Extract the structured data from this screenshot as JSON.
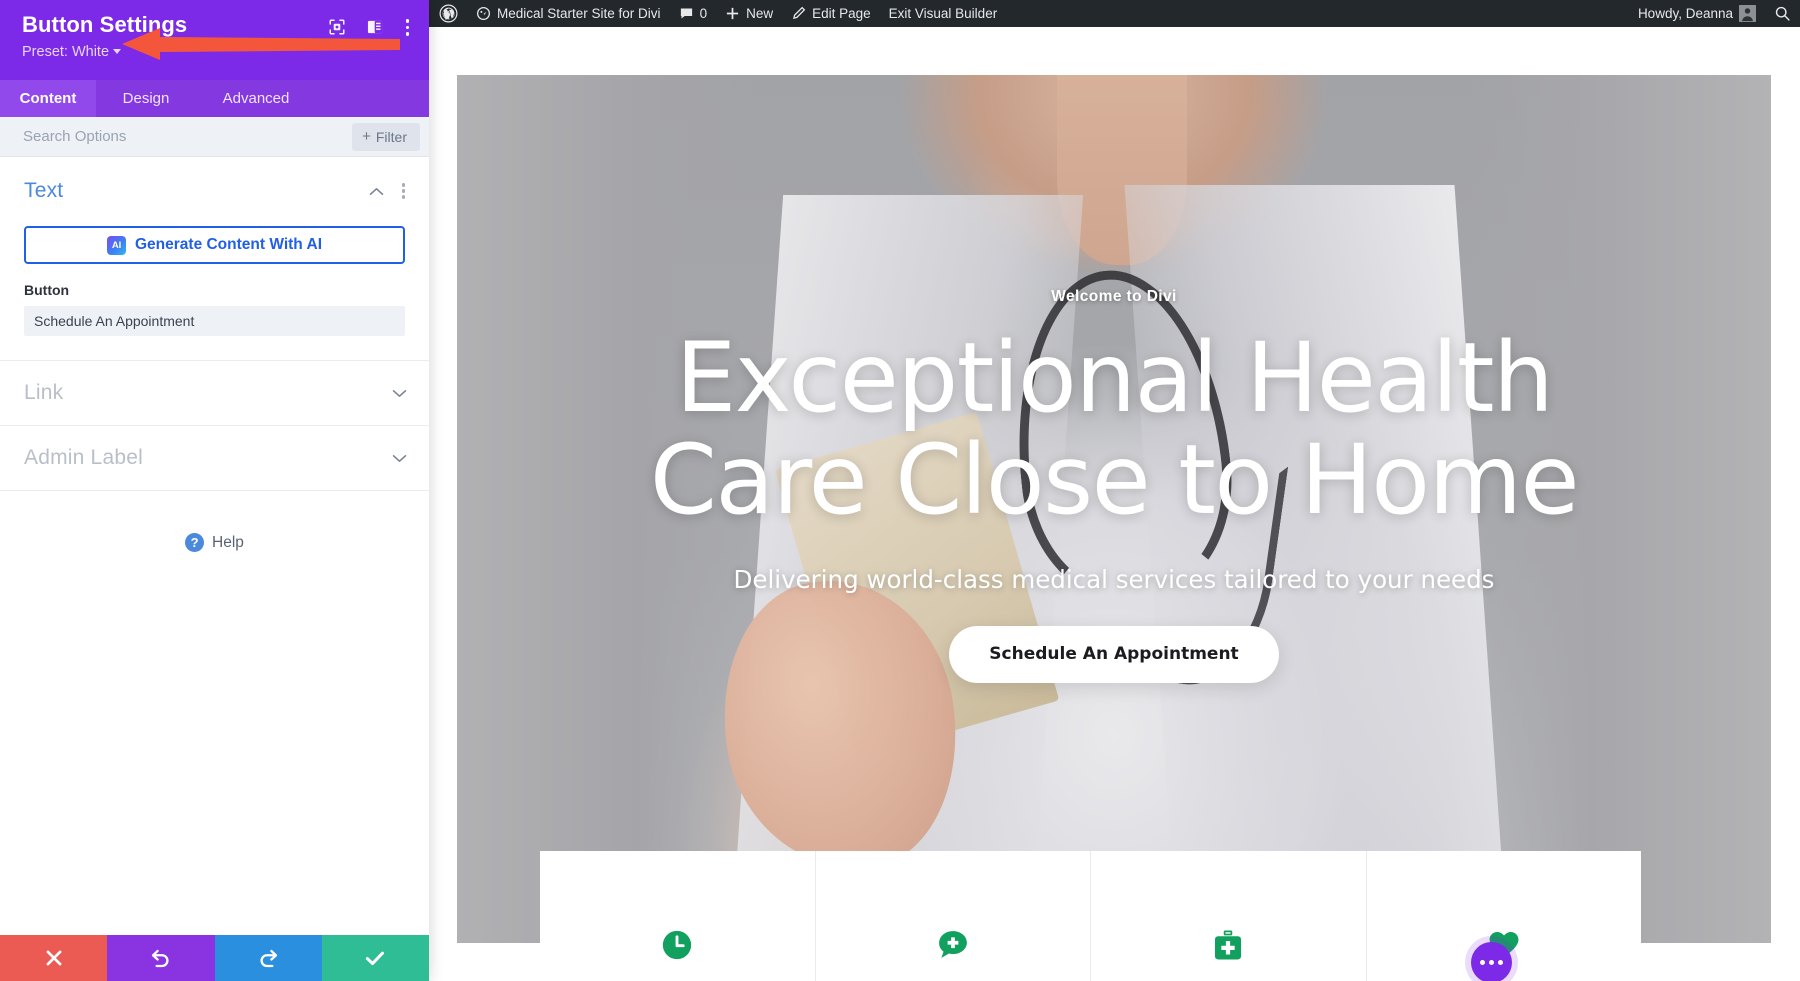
{
  "settings_panel": {
    "title": "Button Settings",
    "preset_label": "Preset: White",
    "header_icons": [
      {
        "name": "focus-target-icon"
      },
      {
        "name": "layout-toggle-icon"
      },
      {
        "name": "kebab-menu-icon"
      }
    ],
    "tabs": [
      {
        "label": "Content",
        "active": true
      },
      {
        "label": "Design",
        "active": false
      },
      {
        "label": "Advanced",
        "active": false
      }
    ],
    "search": {
      "placeholder": "Search Options",
      "value": ""
    },
    "filter_button": {
      "label": "Filter",
      "icon": "plus-icon"
    },
    "text_section": {
      "title": "Text",
      "ai_button": {
        "label": "Generate Content With AI",
        "badge": "AI"
      },
      "button_field": {
        "label": "Button",
        "value": "Schedule An Appointment",
        "placeholder": "Schedule An Appointment"
      }
    },
    "collapsed_sections": [
      {
        "title": "Link"
      },
      {
        "title": "Admin Label"
      }
    ],
    "help": {
      "label": "Help",
      "icon": "question-mark-icon"
    },
    "footer_buttons": [
      {
        "name": "cancel-button",
        "icon": "x-icon",
        "color": "#eb5b53"
      },
      {
        "name": "undo-button",
        "icon": "undo-arrow-icon",
        "color": "#8a33e0"
      },
      {
        "name": "redo-button",
        "icon": "redo-arrow-icon",
        "color": "#2b8fe0"
      },
      {
        "name": "save-button",
        "icon": "checkmark-icon",
        "color": "#2fbd95"
      }
    ],
    "annotation": {
      "type": "red-arrow",
      "color": "#f4563c",
      "points_to": "Preset: White"
    }
  },
  "admin_bar": {
    "wp_logo": "wordpress-logo-icon",
    "site_name": "Medical Starter Site for Divi",
    "comment_count": "0",
    "new_label": "New",
    "edit_page_label": "Edit Page",
    "exit_builder_label": "Exit Visual Builder",
    "howdy": "Howdy, Deanna",
    "search_icon": "search-icon"
  },
  "hero": {
    "eyebrow": "Welcome to Divi",
    "heading_line1": "Exceptional Health",
    "heading_line2": "Care Close to Home",
    "subheading": "Delivering world-class medical services tailored to your needs",
    "button_label": "Schedule An Appointment"
  },
  "feature_cards": [
    {
      "icon": "clock-icon",
      "color": "#12a05f"
    },
    {
      "icon": "chat-plus-icon",
      "color": "#12a05f"
    },
    {
      "icon": "medical-bag-icon",
      "color": "#12a05f"
    },
    {
      "icon": "heart-icon",
      "color": "#12a05f"
    }
  ],
  "divi_hover_menu": {
    "icon": "ellipsis-icon",
    "color": "#7d2ae8"
  },
  "colors": {
    "divi_purple": "#7d2ae8",
    "panel_tab_bar": "#8338e0",
    "accent_blue": "#2160e6",
    "section_title_blue": "#4b89dc",
    "green": "#12a05f",
    "admin_bar": "#23282d"
  }
}
